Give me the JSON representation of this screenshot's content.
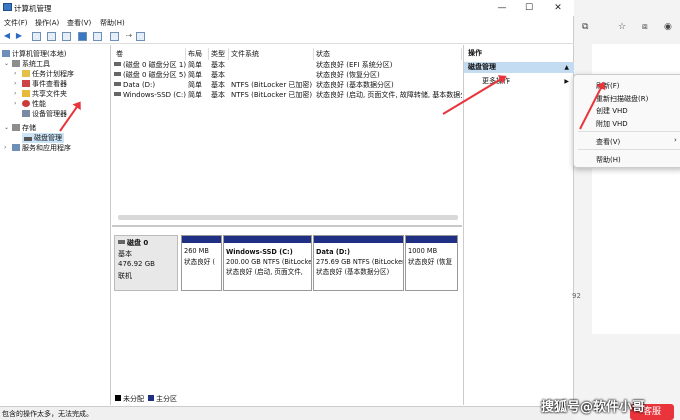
{
  "window": {
    "title": "计算机管理"
  },
  "menubar": [
    "文件(F)",
    "操作(A)",
    "查看(V)",
    "帮助(H)"
  ],
  "tree": {
    "root": "计算机管理(本地)",
    "system_tools": "系统工具",
    "task_scheduler": "任务计划程序",
    "event_viewer": "事件查看器",
    "shared_folders": "共享文件夹",
    "performance": "性能",
    "device_manager": "设备管理器",
    "storage": "存储",
    "disk_management": "磁盘管理",
    "services_apps": "服务和应用程序"
  },
  "volumes": {
    "headers": [
      "卷",
      "布局",
      "类型",
      "文件系统",
      "状态"
    ],
    "rows": [
      [
        "(磁盘 0 磁盘分区 1)",
        "简单",
        "基本",
        "",
        "状态良好 (EFI 系统分区)"
      ],
      [
        "(磁盘 0 磁盘分区 5)",
        "简单",
        "基本",
        "",
        "状态良好 (恢复分区)"
      ],
      [
        "Data (D:)",
        "简单",
        "基本",
        "NTFS (BitLocker 已加密)",
        "状态良好 (基本数据分区)"
      ],
      [
        "Windows-SSD (C:)",
        "简单",
        "基本",
        "NTFS (BitLocker 已加密)",
        "状态良好 (启动, 页面文件, 故障转储, 基本数据分"
      ]
    ]
  },
  "disk": {
    "name": "磁盘 0",
    "type": "基本",
    "size": "476.92 GB",
    "status": "联机",
    "partitions": [
      {
        "name": "",
        "size": "260 MB",
        "status": "状态良好 ("
      },
      {
        "name": "Windows-SSD  (C:)",
        "size": "200.00 GB NTFS (BitLocker",
        "status": "状态良好 (启动, 页面文件,"
      },
      {
        "name": "Data  (D:)",
        "size": "275.69 GB NTFS (BitLocker",
        "status": "状态良好 (基本数据分区)"
      },
      {
        "name": "",
        "size": "1000 MB",
        "status": "状态良好 (恢复"
      }
    ]
  },
  "legend": {
    "unallocated": "未分配",
    "primary": "主分区"
  },
  "actions": {
    "title": "操作",
    "section": "磁盘管理",
    "more": "更多操作"
  },
  "context_menu": [
    "刷新(F)",
    "重新扫描磁盘(R)",
    "创建 VHD",
    "附加 VHD",
    "查看(V)",
    "帮助(H)"
  ],
  "status": "包含的操作太多，无法完成。",
  "watermark": "搜狐号@软件小哥",
  "browser": {
    "page_number": "92",
    "badge": "客服"
  },
  "colors": {
    "primary_partition": "#1f2f84",
    "selection": "#cce4f7",
    "accent": "#e8343a"
  }
}
